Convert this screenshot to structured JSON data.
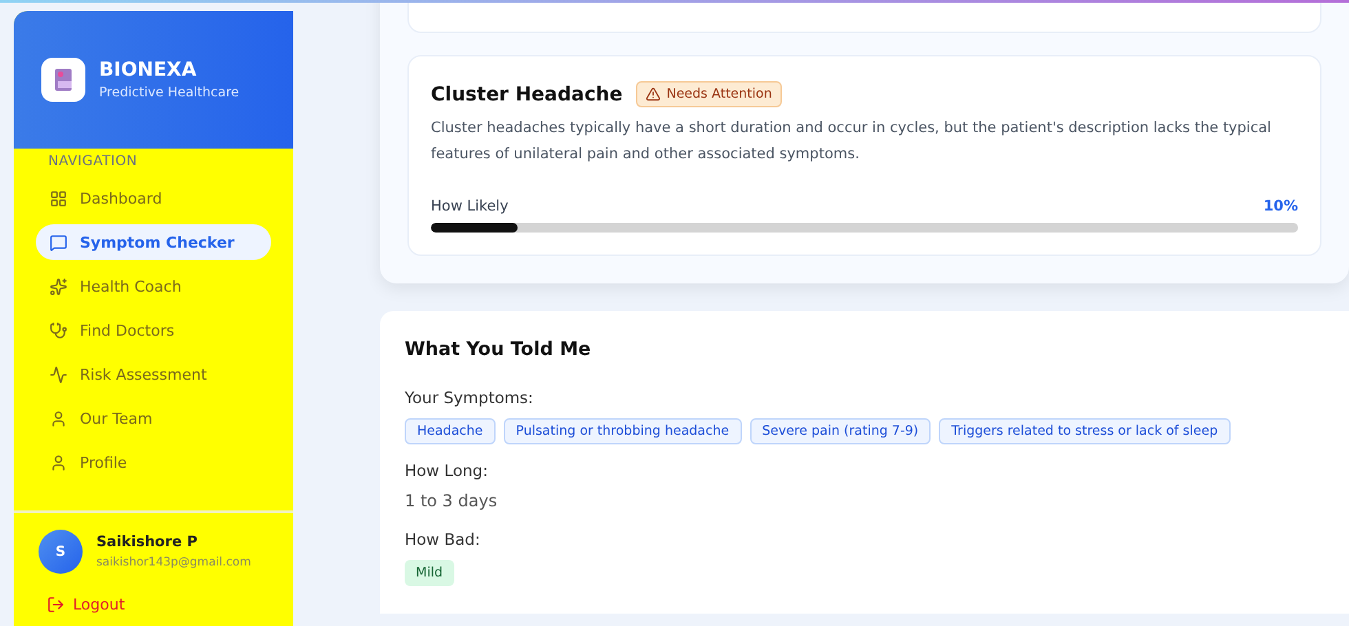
{
  "brand": {
    "name": "BIONEXA",
    "tagline": "Predictive Healthcare"
  },
  "navigation": {
    "heading": "NAVIGATION",
    "items": [
      {
        "label": "Dashboard",
        "kind": "grid",
        "selected": false
      },
      {
        "label": "Symptom Checker",
        "kind": "chat",
        "selected": true
      },
      {
        "label": "Health Coach",
        "kind": "sparkles",
        "selected": false
      },
      {
        "label": "Find Doctors",
        "kind": "stethoscope",
        "selected": false
      },
      {
        "label": "Risk Assessment",
        "kind": "activity",
        "selected": false
      },
      {
        "label": "Our Team",
        "kind": "person",
        "selected": false
      },
      {
        "label": "Profile",
        "kind": "person",
        "selected": false
      }
    ]
  },
  "user": {
    "initial": "S",
    "name": "Saikishore P",
    "email": "saikishor143p@gmail.com"
  },
  "logout": "Logout",
  "condition": {
    "title": "Cluster Headache",
    "badge": "Needs Attention",
    "description": "Cluster headaches typically have a short duration and occur in cycles, but the patient's description lacks the typical features of unilateral pain and other associated symptoms.",
    "likelihood_label": "How Likely",
    "likelihood_value": "10%",
    "level": 0.1
  },
  "summary": {
    "title": "What You Told Me",
    "symptoms_label": "Your Symptoms:",
    "symptoms": [
      "Headache",
      "Pulsating or throbbing headache",
      "Severe pain (rating 7-9)",
      "Triggers related to stress or lack of sleep"
    ],
    "duration_label": "How Long:",
    "duration": "1 to 3 days",
    "severity_label": "How Bad:",
    "severity": "Mild"
  }
}
